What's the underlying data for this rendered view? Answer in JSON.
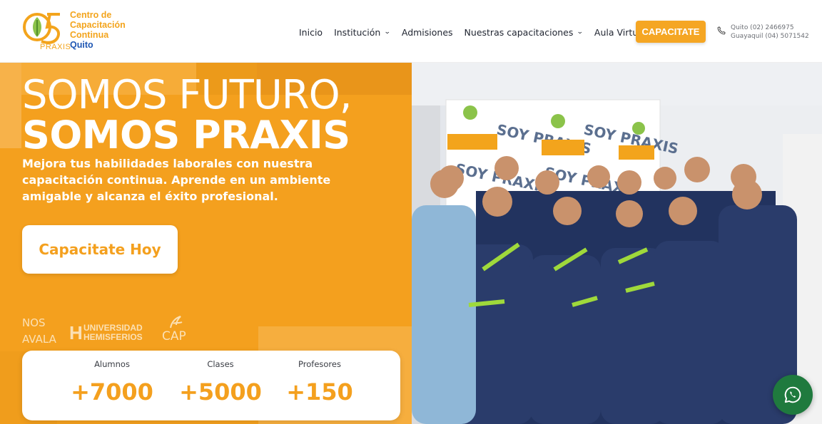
{
  "header": {
    "logo": {
      "mark_text": "95",
      "brand": "PRAXIS",
      "lines": [
        "Centro de",
        "Capacitación",
        "Continua"
      ],
      "city": "Quito"
    },
    "nav": [
      {
        "label": "Inicio",
        "dropdown": false
      },
      {
        "label": "Institución",
        "dropdown": true
      },
      {
        "label": "Admisiones",
        "dropdown": false
      },
      {
        "label": "Nuestras capacitaciones",
        "dropdown": true
      },
      {
        "label": "Aula Virtual",
        "dropdown": false
      }
    ],
    "cta_label": "CAPACITATE",
    "phones": [
      "Quito (02) 2466975",
      "Guayaquil (04) 5071542"
    ]
  },
  "hero": {
    "headline_line1": "SOMOS FUTURO,",
    "headline_line2": "SOMOS PRAXIS",
    "subtitle": "Mejora tus habilidades laborales con nuestra capacitación continua. Aprende en un ambiente amigable y alcanza el éxito profesional.",
    "button_label": "Capacitate Hoy",
    "endorse_line1": "NOS",
    "endorse_line2": "AVALA",
    "partner1_letter": "H",
    "partner1_line1": "UNIVERSIDAD",
    "partner1_line2": "HEMISFERIOS",
    "partner2": "CAP"
  },
  "stats": [
    {
      "label": "Alumnos",
      "value": "+7000"
    },
    {
      "label": "Clases",
      "value": "+5000"
    },
    {
      "label": "Profesores",
      "value": "+150"
    }
  ],
  "photo": {
    "banner_text": "SOY PRAXIS"
  },
  "colors": {
    "brand_orange": "#f4a01e",
    "brand_blue": "#1e56b3",
    "scrubs": "#22335f",
    "whatsapp": "#1f7a3e"
  },
  "icons": {
    "phone": "phone-icon",
    "whatsapp": "whatsapp-icon",
    "chevron": "chevron-down-icon"
  }
}
